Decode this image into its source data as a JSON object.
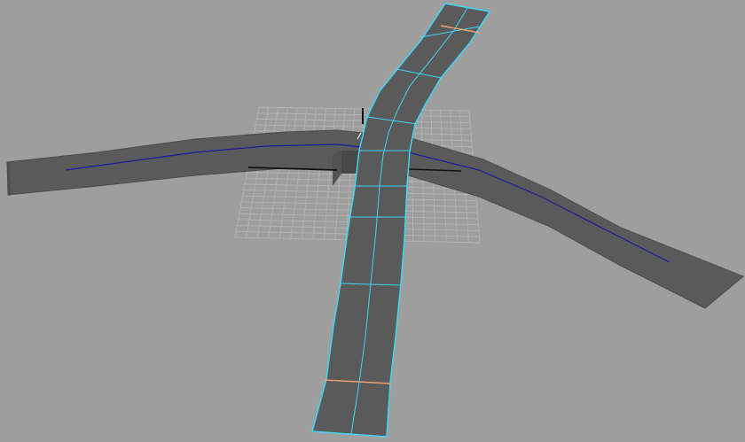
{
  "viewport": {
    "name": "perspective-viewport",
    "background_color": "#9e9e9e"
  },
  "colors": {
    "road_surface": "#5a5a5a",
    "road_surface_dark": "#505050",
    "selection_highlight": "#3fd6f5",
    "curve": "#1a1aa0",
    "edge_marker": "#e8a070",
    "grid": "#b4b4b4",
    "axis": "#111111",
    "intersection_block": "#484848"
  },
  "objects": {
    "horizontal_road": {
      "name": "road-mesh-horizontal",
      "selected": false
    },
    "vertical_road": {
      "name": "road-mesh-vertical",
      "selected": true
    },
    "ground_grid": {
      "name": "ground-grid",
      "visible": true
    },
    "guide_curve": {
      "name": "road-guide-curve",
      "visible": true
    }
  }
}
